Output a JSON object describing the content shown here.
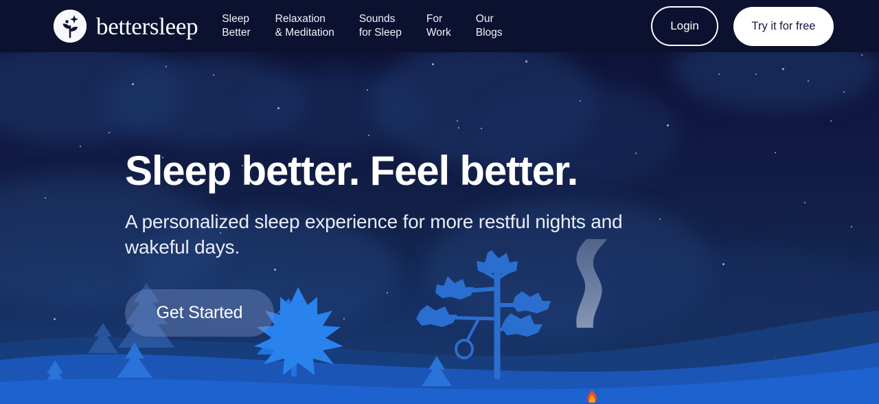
{
  "brand": {
    "name": "bettersleep",
    "logo_icon": "sprout-sparkle-icon"
  },
  "nav": {
    "items": [
      {
        "line1": "Sleep",
        "line2": "Better"
      },
      {
        "line1": "Relaxation",
        "line2": "& Meditation"
      },
      {
        "line1": "Sounds",
        "line2": "for Sleep"
      },
      {
        "line1": "For",
        "line2": "Work"
      },
      {
        "line1": "Our",
        "line2": "Blogs"
      }
    ]
  },
  "actions": {
    "login_label": "Login",
    "try_label": "Try it for free"
  },
  "hero": {
    "headline": "Sleep better. Feel better.",
    "subheadline": "A personalized sleep experience for more restful nights and wakeful days.",
    "cta_label": "Get Started"
  },
  "scene": {
    "elements": [
      "pine-tree",
      "deciduous-tree",
      "tire-swing",
      "campfire",
      "smoke",
      "hills"
    ]
  },
  "colors": {
    "page_background": "#0d1130",
    "sky_top": "#0d1130",
    "sky_bottom": "#143569",
    "cloud": "#1e386e",
    "text_primary": "#ffffff",
    "text_secondary": "#e9edf7",
    "button_light": "#ffffff",
    "button_light_text": "#14173a",
    "cta_fill": "rgba(120,142,196,0.42)",
    "tree_blue": "#1f61c9",
    "tree_blue_dark": "#1a4da3",
    "hill_blue": "#1c58bd",
    "hill_blue_dark": "#17407f",
    "smoke": "#7c8cae",
    "flame": "#f04b18"
  }
}
